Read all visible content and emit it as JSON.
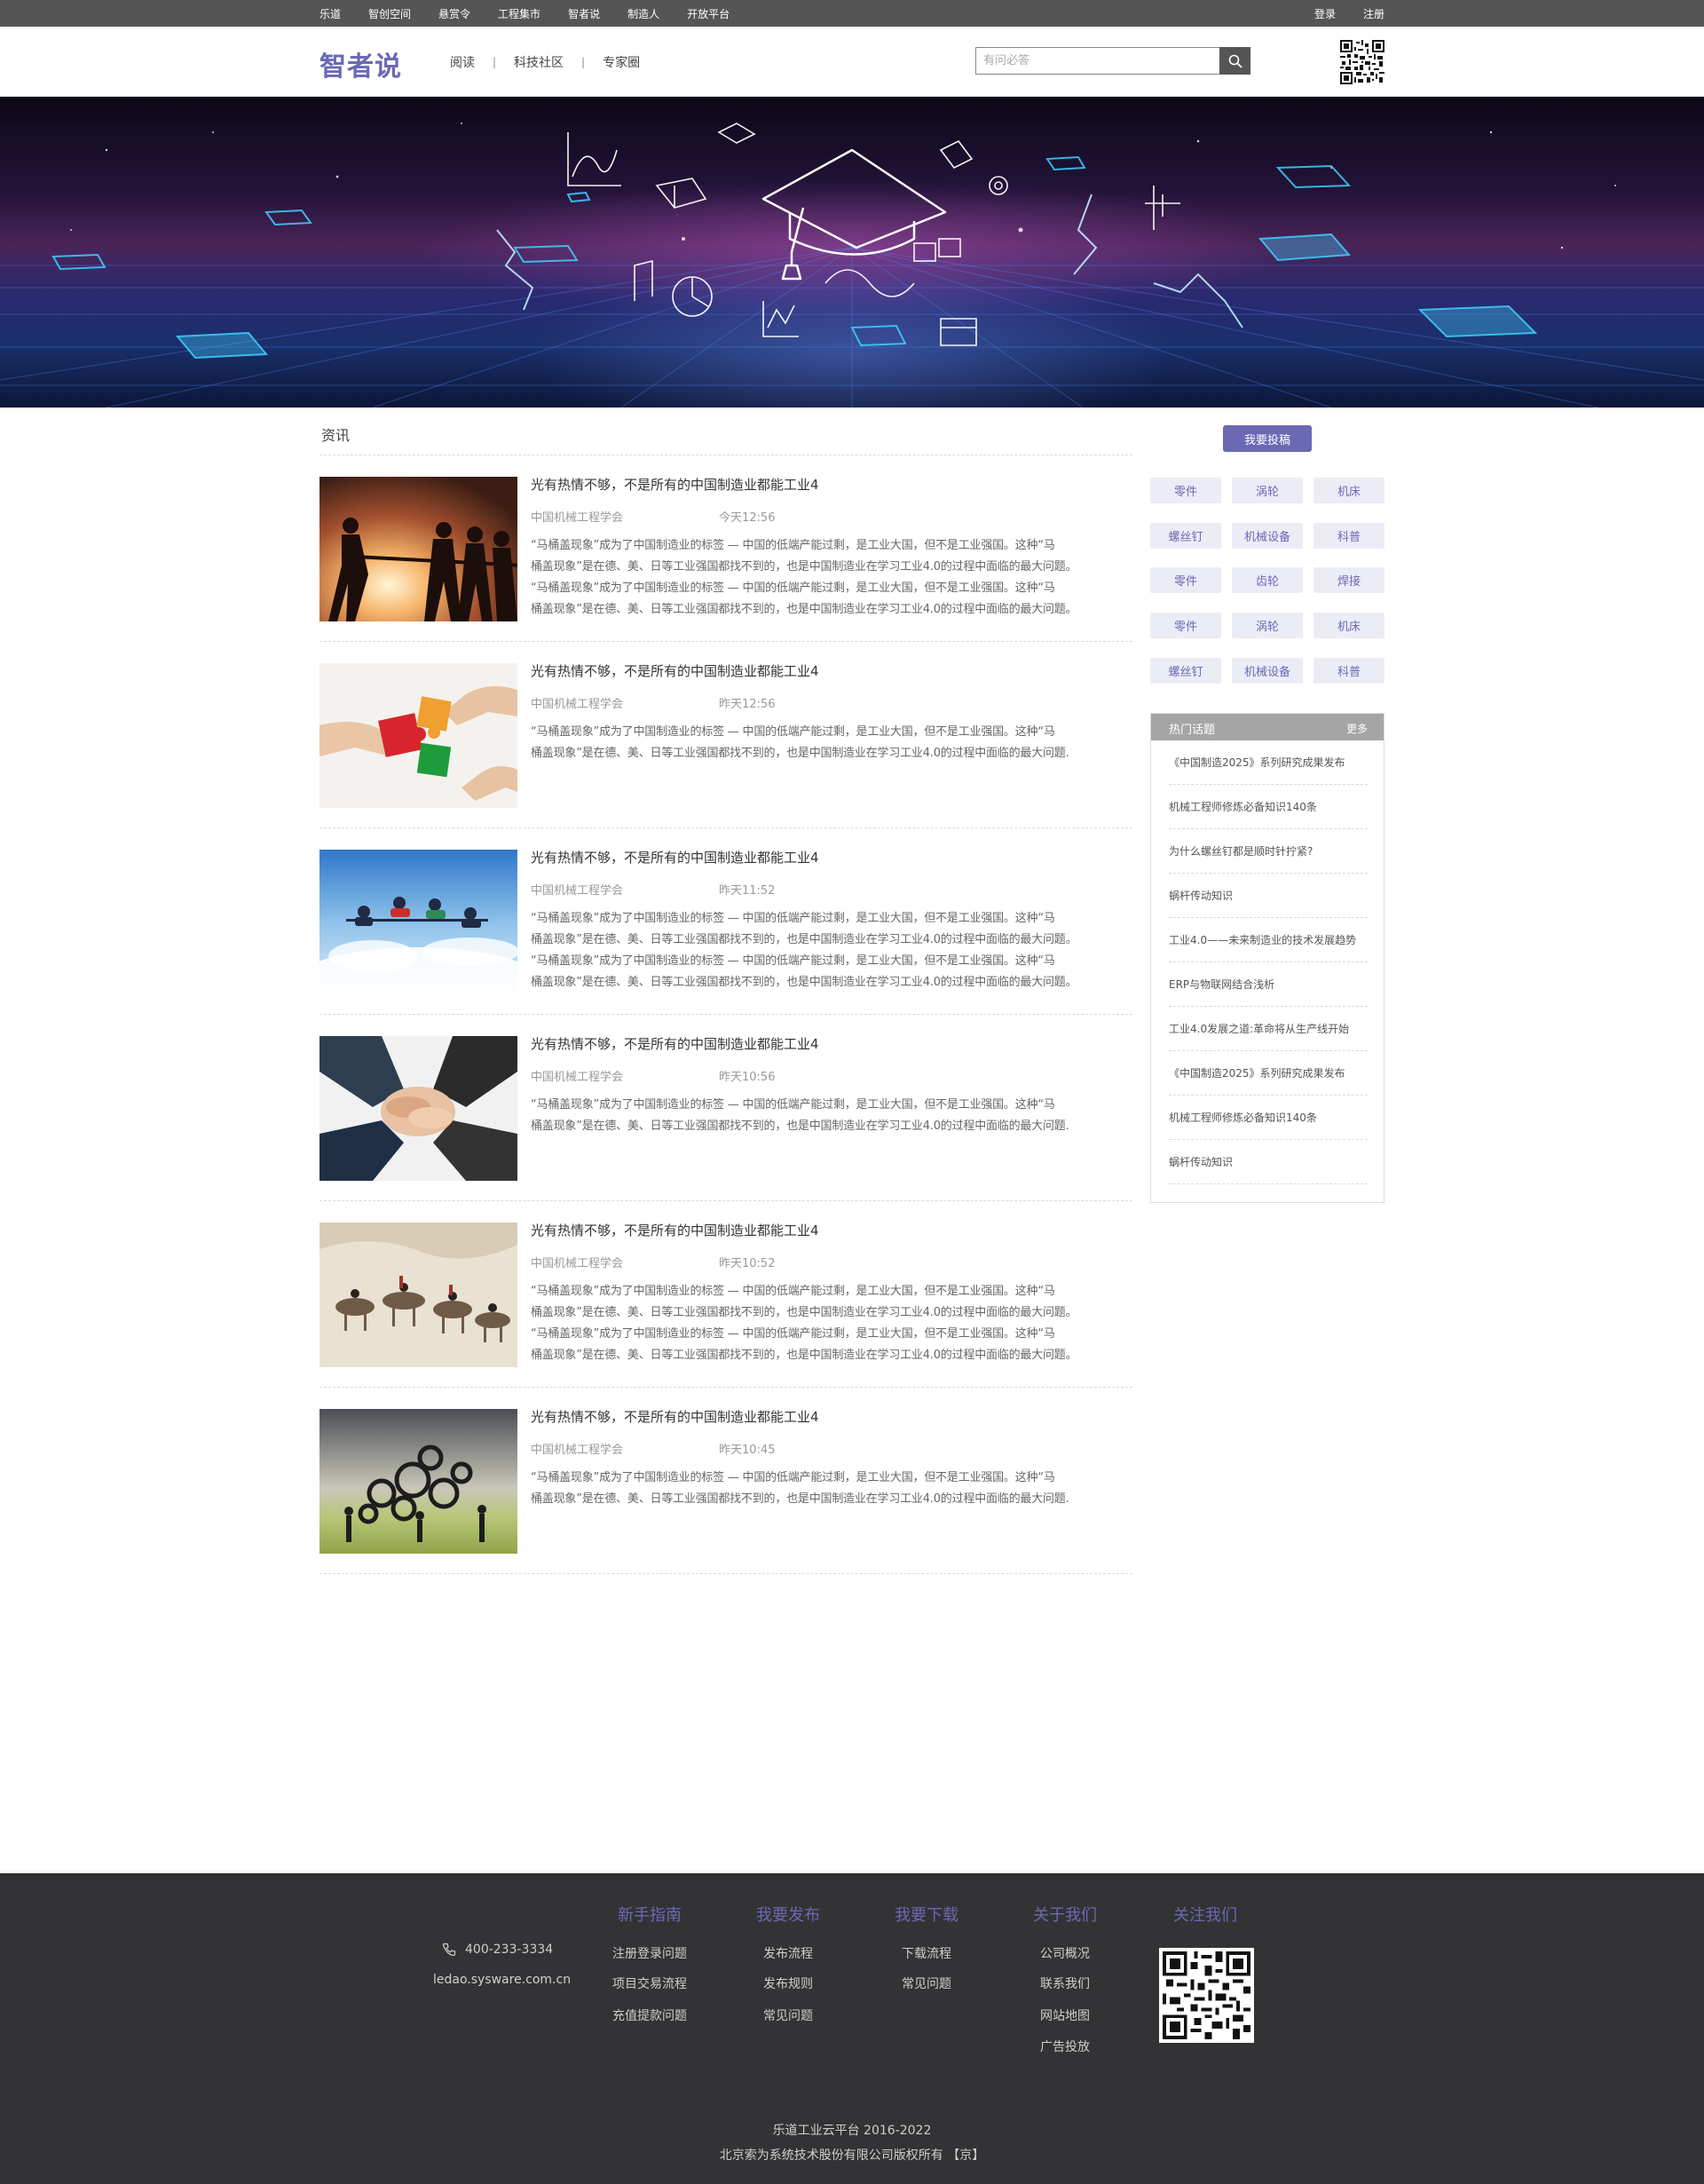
{
  "topbar": {
    "nav": [
      "乐道",
      "智创空间",
      "悬赏令",
      "工程集市",
      "智者说",
      "制造人",
      "开放平台"
    ],
    "login": "登录",
    "register": "注册"
  },
  "header": {
    "logo": "智者说",
    "nav": [
      "阅读",
      "科技社区",
      "专家圈"
    ],
    "search_placeholder": "有问必答"
  },
  "main": {
    "section_title": "资讯",
    "articles": [
      {
        "title": "光有热情不够，不是所有的中国制造业都能工业4",
        "source": "中国机械工程学会",
        "time": "今天12:56",
        "summary": [
          "“马桶盖现象”成为了中国制造业的标签 — 中国的低端产能过剩，是工业大国，但不是工业强国。这种“马",
          "桶盖现象”是在德、美、日等工业强国都找不到的，也是中国制造业在学习工业4.0的过程中面临的最大问题。",
          "“马桶盖现象”成为了中国制造业的标签 — 中国的低端产能过剩，是工业大国，但不是工业强国。这种“马",
          "桶盖现象”是在德、美、日等工业强国都找不到的，也是中国制造业在学习工业4.0的过程中面临的最大问题。"
        ]
      },
      {
        "title": "光有热情不够，不是所有的中国制造业都能工业4",
        "source": "中国机械工程学会",
        "time": "昨天12:56",
        "summary": [
          "“马桶盖现象”成为了中国制造业的标签 — 中国的低端产能过剩，是工业大国，但不是工业强国。这种“马",
          "桶盖现象”是在德、美、日等工业强国都找不到的，也是中国制造业在学习工业4.0的过程中面临的最大问题."
        ]
      },
      {
        "title": "光有热情不够，不是所有的中国制造业都能工业4",
        "source": "中国机械工程学会",
        "time": "昨天11:52",
        "summary": [
          "“马桶盖现象”成为了中国制造业的标签 — 中国的低端产能过剩，是工业大国，但不是工业强国。这种“马",
          "桶盖现象”是在德、美、日等工业强国都找不到的，也是中国制造业在学习工业4.0的过程中面临的最大问题。",
          "“马桶盖现象”成为了中国制造业的标签 — 中国的低端产能过剩，是工业大国，但不是工业强国。这种“马",
          "桶盖现象”是在德、美、日等工业强国都找不到的，也是中国制造业在学习工业4.0的过程中面临的最大问题。"
        ]
      },
      {
        "title": "光有热情不够，不是所有的中国制造业都能工业4",
        "source": "中国机械工程学会",
        "time": "昨天10:56",
        "summary": [
          "“马桶盖现象”成为了中国制造业的标签 — 中国的低端产能过剩，是工业大国，但不是工业强国。这种“马",
          "桶盖现象”是在德、美、日等工业强国都找不到的，也是中国制造业在学习工业4.0的过程中面临的最大问题."
        ]
      },
      {
        "title": "光有热情不够，不是所有的中国制造业都能工业4",
        "source": "中国机械工程学会",
        "time": "昨天10:52",
        "summary": [
          "“马桶盖现象”成为了中国制造业的标签 — 中国的低端产能过剩，是工业大国，但不是工业强国。这种“马",
          "桶盖现象”是在德、美、日等工业强国都找不到的，也是中国制造业在学习工业4.0的过程中面临的最大问题。",
          "“马桶盖现象”成为了中国制造业的标签 — 中国的低端产能过剩，是工业大国，但不是工业强国。这种“马",
          "桶盖现象”是在德、美、日等工业强国都找不到的，也是中国制造业在学习工业4.0的过程中面临的最大问题。"
        ]
      },
      {
        "title": "光有热情不够，不是所有的中国制造业都能工业4",
        "source": "中国机械工程学会",
        "time": "昨天10:45",
        "summary": [
          "“马桶盖现象”成为了中国制造业的标签 — 中国的低端产能过剩，是工业大国，但不是工业强国。这种“马",
          "桶盖现象”是在德、美、日等工业强国都找不到的，也是中国制造业在学习工业4.0的过程中面临的最大问题."
        ]
      }
    ]
  },
  "sidebar": {
    "submit_label": "我要投稿",
    "tags": [
      "零件",
      "涡轮",
      "机床",
      "螺丝钉",
      "机械设备",
      "科普",
      "零件",
      "齿轮",
      "焊接",
      "零件",
      "涡轮",
      "机床",
      "螺丝钉",
      "机械设备",
      "科普"
    ],
    "hot": {
      "title": "热门话题",
      "more": "更多",
      "items": [
        "《中国制造2025》系列研究成果发布",
        "机械工程师修炼必备知识140条",
        "为什么螺丝钉都是顺时针拧紧?",
        "蜗杆传动知识",
        "工业4.0——未来制造业的技术发展趋势",
        "ERP与物联网结合浅析",
        "工业4.0发展之道:革命将从生产线开始",
        "《中国制造2025》系列研究成果发布",
        "机械工程师修炼必备知识140条",
        "蜗杆传动知识"
      ]
    }
  },
  "footer": {
    "phone": "400-233-3334",
    "site": "ledao.sysware.com.cn",
    "columns": [
      {
        "heading": "新手指南",
        "items": [
          "注册登录问题",
          "项目交易流程",
          "充值提款问题"
        ]
      },
      {
        "heading": "我要发布",
        "items": [
          "发布流程",
          "发布规则",
          "常见问题"
        ]
      },
      {
        "heading": "我要下载",
        "items": [
          "下载流程",
          "常见问题"
        ]
      },
      {
        "heading": "关于我们",
        "items": [
          "公司概况",
          "联系我们",
          "网站地图",
          "广告投放"
        ]
      },
      {
        "heading": "关注我们",
        "items": []
      }
    ],
    "copyright": "乐道工业云平台 2016-2022",
    "company": "北京索为系统技术股份有限公司版权所有 【京】"
  },
  "colors": {
    "accent": "#6b68b4",
    "topbar": "#555555",
    "footer": "#333336",
    "tag_bg": "#ececf7"
  }
}
